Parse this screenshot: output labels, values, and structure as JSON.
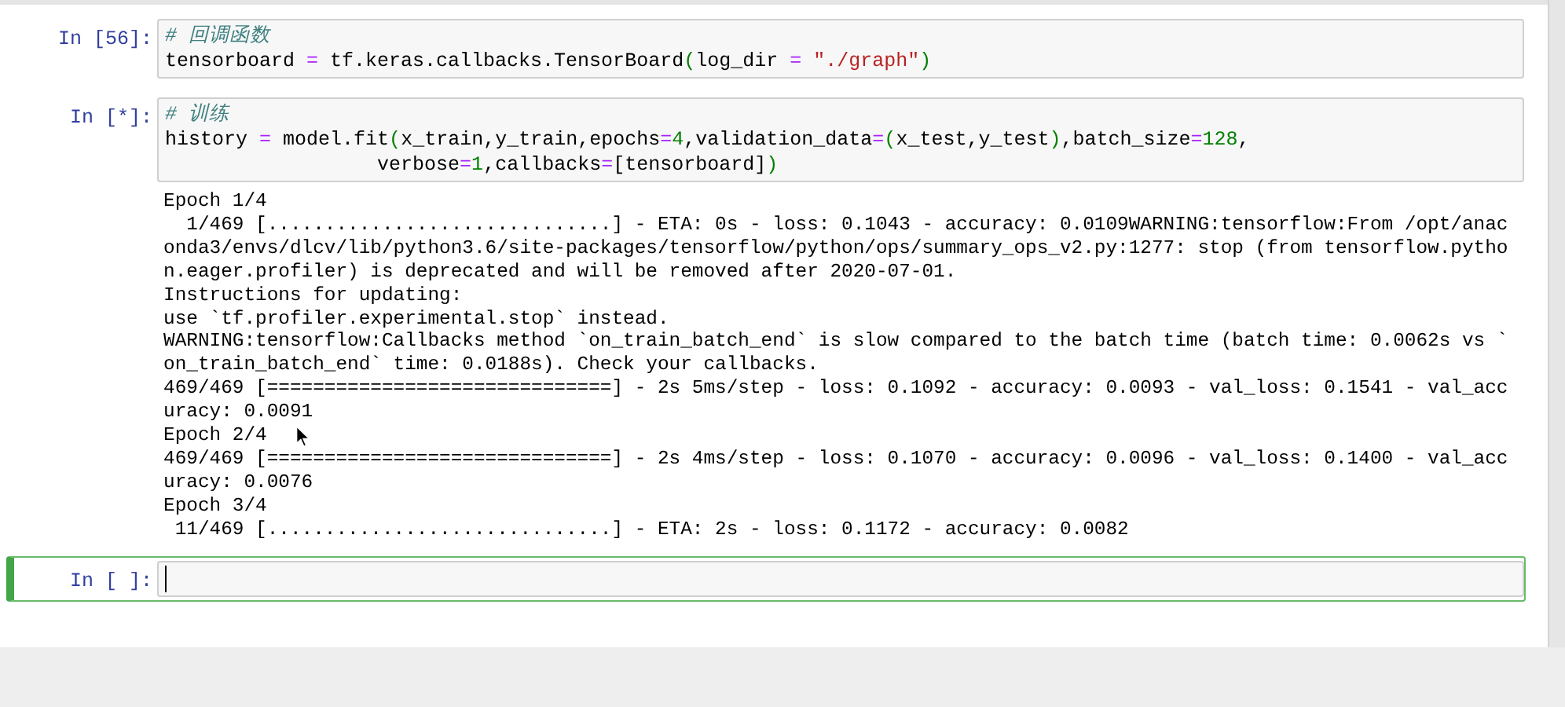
{
  "cells": [
    {
      "prompt": "In [56]:",
      "selected": false,
      "code": [
        [
          {
            "kind": "comment",
            "text": "# 回调函数"
          }
        ],
        [
          {
            "kind": "plain",
            "text": "tensorboard "
          },
          {
            "kind": "op",
            "text": "="
          },
          {
            "kind": "plain",
            "text": " tf.keras.callbacks.TensorBoard"
          },
          {
            "kind": "paren",
            "text": "("
          },
          {
            "kind": "plain",
            "text": "log_dir "
          },
          {
            "kind": "op",
            "text": "="
          },
          {
            "kind": "string",
            "text": " \"./graph\""
          },
          {
            "kind": "paren",
            "text": ")"
          }
        ]
      ]
    },
    {
      "prompt": "In [*]:",
      "selected": false,
      "code": [
        [
          {
            "kind": "comment",
            "text": "# 训练"
          }
        ],
        [
          {
            "kind": "plain",
            "text": "history "
          },
          {
            "kind": "op",
            "text": "="
          },
          {
            "kind": "plain",
            "text": " model.fit"
          },
          {
            "kind": "paren",
            "text": "("
          },
          {
            "kind": "plain",
            "text": "x_train,y_train,epochs"
          },
          {
            "kind": "op",
            "text": "="
          },
          {
            "kind": "number",
            "text": "4"
          },
          {
            "kind": "plain",
            "text": ",validation_data"
          },
          {
            "kind": "op",
            "text": "="
          },
          {
            "kind": "paren",
            "text": "("
          },
          {
            "kind": "plain",
            "text": "x_test,y_test"
          },
          {
            "kind": "paren",
            "text": ")"
          },
          {
            "kind": "plain",
            "text": ",batch_size"
          },
          {
            "kind": "op",
            "text": "="
          },
          {
            "kind": "number",
            "text": "128"
          },
          {
            "kind": "plain",
            "text": ","
          }
        ],
        [
          {
            "kind": "plain",
            "text": "                  verbose"
          },
          {
            "kind": "op",
            "text": "="
          },
          {
            "kind": "number",
            "text": "1"
          },
          {
            "kind": "plain",
            "text": ",callbacks"
          },
          {
            "kind": "op",
            "text": "="
          },
          {
            "kind": "plain",
            "text": "[tensorboard]"
          },
          {
            "kind": "paren",
            "text": ")"
          }
        ]
      ],
      "output": [
        "Epoch 1/4",
        "  1/469 [..............................] - ETA: 0s - loss: 0.1043 - accuracy: 0.0109WARNING:tensorflow:From /opt/anac",
        "onda3/envs/dlcv/lib/python3.6/site-packages/tensorflow/python/ops/summary_ops_v2.py:1277: stop (from tensorflow.pytho",
        "n.eager.profiler) is deprecated and will be removed after 2020-07-01.",
        "Instructions for updating:",
        "use `tf.profiler.experimental.stop` instead.",
        "WARNING:tensorflow:Callbacks method `on_train_batch_end` is slow compared to the batch time (batch time: 0.0062s vs `",
        "on_train_batch_end` time: 0.0188s). Check your callbacks.",
        "469/469 [==============================] - 2s 5ms/step - loss: 0.1092 - accuracy: 0.0093 - val_loss: 0.1541 - val_acc",
        "uracy: 0.0091",
        "Epoch 2/4",
        "469/469 [==============================] - 2s 4ms/step - loss: 0.1070 - accuracy: 0.0096 - val_loss: 0.1400 - val_acc",
        "uracy: 0.0076",
        "Epoch 3/4",
        " 11/469 [..............................] - ETA: 2s - loss: 0.1172 - accuracy: 0.0082"
      ]
    },
    {
      "prompt": "In [ ]:",
      "selected": true
    }
  ]
}
